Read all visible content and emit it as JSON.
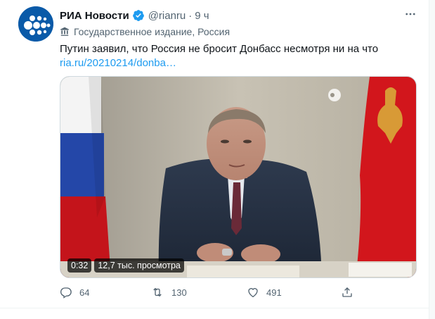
{
  "tweet": {
    "author_name": "РИА Новости",
    "handle": "@rianru",
    "separator": "·",
    "time": "9 ч",
    "label": "Государственное издание, Россия",
    "text": "Путин заявил, что Россия не бросит Донбасс несмотря ни на что",
    "link": "ria.ru/20210214/donba…"
  },
  "video": {
    "duration": "0:32",
    "views": "12,7 тыс. просмотра"
  },
  "actions": {
    "replies": "64",
    "retweets": "130",
    "likes": "491"
  },
  "colors": {
    "accent": "#1d9bf0",
    "secondary_text": "#536471",
    "avatar_bg": "#0a5aa8"
  },
  "icons": [
    "ria-logo-icon",
    "verified-badge-icon",
    "more-icon",
    "state-media-icon",
    "reply-icon",
    "retweet-icon",
    "like-icon",
    "share-icon"
  ]
}
